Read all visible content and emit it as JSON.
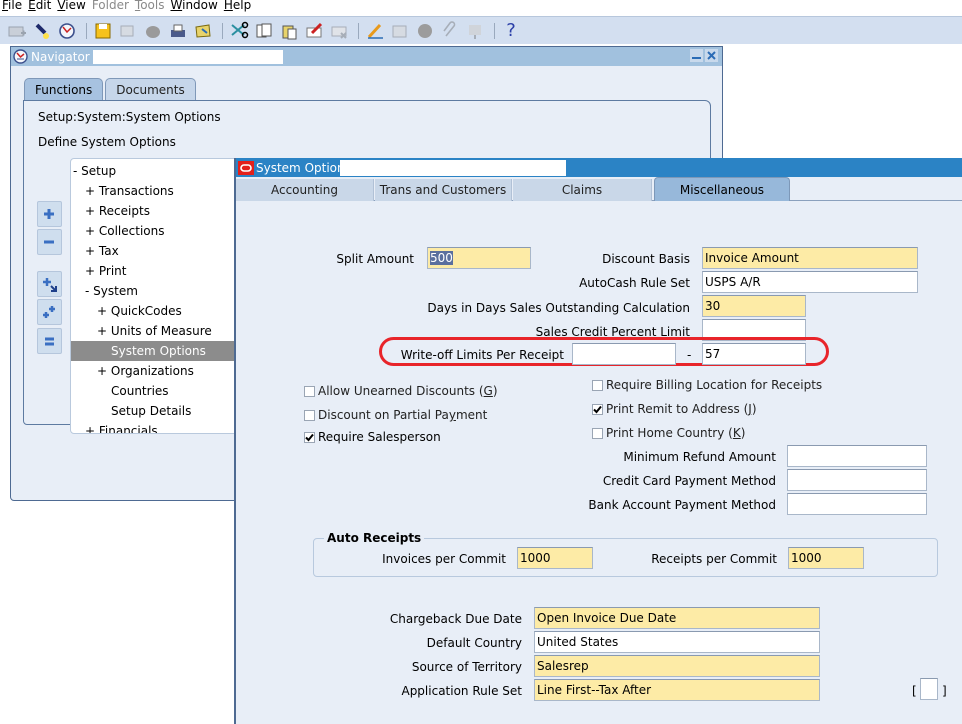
{
  "menubar": {
    "items": [
      {
        "label": "File",
        "mnemonic": "F",
        "rest": "ile",
        "enabled": true
      },
      {
        "label": "Edit",
        "mnemonic": "E",
        "rest": "dit",
        "enabled": true
      },
      {
        "label": "View",
        "mnemonic": "V",
        "rest": "iew",
        "enabled": true
      },
      {
        "label": "Folder",
        "mnemonic": "",
        "rest": "Folder",
        "enabled": false
      },
      {
        "label": "Tools",
        "mnemonic": "T",
        "rest": "ools",
        "enabled": false
      },
      {
        "label": "Window",
        "mnemonic": "W",
        "rest": "indow",
        "enabled": true
      },
      {
        "label": "Help",
        "mnemonic": "H",
        "rest": "elp",
        "enabled": true
      }
    ]
  },
  "toolbar": {
    "icons": [
      "new-record-icon",
      "find-icon",
      "navigator-icon",
      "save-icon",
      "next-step-icon",
      "switch-responsibility-icon",
      "print-icon",
      "close-form-icon",
      "cut-icon",
      "copy-icon",
      "paste-icon",
      "clear-record-icon",
      "delete-record-icon",
      "edit-field-icon",
      "zoom-icon",
      "translations-icon",
      "attachments-icon",
      "folder-tools-icon",
      "help-icon"
    ],
    "help_label": "?"
  },
  "navigator": {
    "title": "Navigator - ",
    "tabs": [
      {
        "label": "Functions",
        "active": true
      },
      {
        "label": "Documents",
        "active": false
      }
    ],
    "path": "Setup:System:System Options",
    "description": "Define System Options",
    "tree": [
      {
        "label": "- Setup",
        "indent": 0,
        "selected": false
      },
      {
        "label": "+ Transactions",
        "indent": 1,
        "selected": false
      },
      {
        "label": "+ Receipts",
        "indent": 1,
        "selected": false
      },
      {
        "label": "+ Collections",
        "indent": 1,
        "selected": false
      },
      {
        "label": "+ Tax",
        "indent": 1,
        "selected": false
      },
      {
        "label": "+ Print",
        "indent": 1,
        "selected": false
      },
      {
        "label": "- System",
        "indent": 1,
        "selected": false
      },
      {
        "label": "+ QuickCodes",
        "indent": 2,
        "selected": false
      },
      {
        "label": "+ Units of Measure",
        "indent": 2,
        "selected": false
      },
      {
        "label": "System Options",
        "indent": 3,
        "selected": true
      },
      {
        "label": "+ Organizations",
        "indent": 2,
        "selected": false
      },
      {
        "label": "Countries",
        "indent": 3,
        "selected": false
      },
      {
        "label": "Setup Details",
        "indent": 3,
        "selected": false
      },
      {
        "label": "+ Financials",
        "indent": 1,
        "selected": false
      }
    ],
    "side_buttons": [
      "expand-icon",
      "collapse-icon",
      "expand-branch-icon",
      "expand-all-icon",
      "collapse-all-icon"
    ]
  },
  "system_options": {
    "title": "System Options",
    "tabs": [
      {
        "label": "Accounting",
        "active": false
      },
      {
        "label": "Trans and Customers",
        "active": false
      },
      {
        "label": "Claims",
        "active": false
      },
      {
        "label": "Miscellaneous",
        "active": true
      }
    ],
    "fields": {
      "split_amount": {
        "label": "Split Amount",
        "value": "500"
      },
      "discount_basis": {
        "label": "Discount Basis",
        "value": "Invoice Amount"
      },
      "autocash_rule_set": {
        "label": "AutoCash Rule Set",
        "value": "USPS A/R"
      },
      "days_dso": {
        "label": "Days in Days Sales Outstanding Calculation",
        "value": "30"
      },
      "sales_credit_pct": {
        "label": "Sales Credit Percent Limit",
        "value": ""
      },
      "writeoff_limits": {
        "label": "Write-off Limits Per Receipt",
        "from": "",
        "separator": "-",
        "to": "57"
      },
      "min_refund": {
        "label": "Minimum Refund Amount",
        "value": ""
      },
      "cc_payment_method": {
        "label": "Credit Card Payment Method",
        "value": ""
      },
      "bank_payment_method": {
        "label": "Bank Account Payment Method",
        "value": ""
      },
      "chargeback_due_date": {
        "label": "Chargeback Due Date",
        "value": "Open Invoice Due Date"
      },
      "default_country": {
        "label": "Default Country",
        "value": "United States"
      },
      "source_of_territory": {
        "label": "Source of Territory",
        "value": "Salesrep"
      },
      "application_rule_set": {
        "label": "Application Rule Set",
        "value": "Line First--Tax After"
      }
    },
    "checkboxes": {
      "allow_unearned": {
        "label": "Allow Unearned Discounts (",
        "mn": "G",
        "end": ")",
        "checked": false
      },
      "discount_partial": {
        "label": "Discount on Partial Pa",
        "mn": "y",
        "end": "ment",
        "checked": false
      },
      "require_salesperson": {
        "label": "Require Salesperson",
        "mn": "",
        "end": "",
        "checked": true
      },
      "require_billing_loc": {
        "label": "Require Billing Location for Receipts",
        "mn": "",
        "end": "",
        "checked": false
      },
      "print_remit": {
        "label": "Print Remit to Address (",
        "mn": "J",
        "end": ")",
        "checked": true
      },
      "print_home_country": {
        "label": "Print Home Country (",
        "mn": "K",
        "end": ")",
        "checked": false
      }
    },
    "auto_receipts": {
      "title": "Auto Receipts",
      "invoices_per_commit": {
        "label": "Invoices per Commit",
        "value": "1000"
      },
      "receipts_per_commit": {
        "label": "Receipts per Commit",
        "value": "1000"
      }
    },
    "dff": {
      "open": "[",
      "close": "]"
    },
    "highlight_color": "#e8242a"
  }
}
